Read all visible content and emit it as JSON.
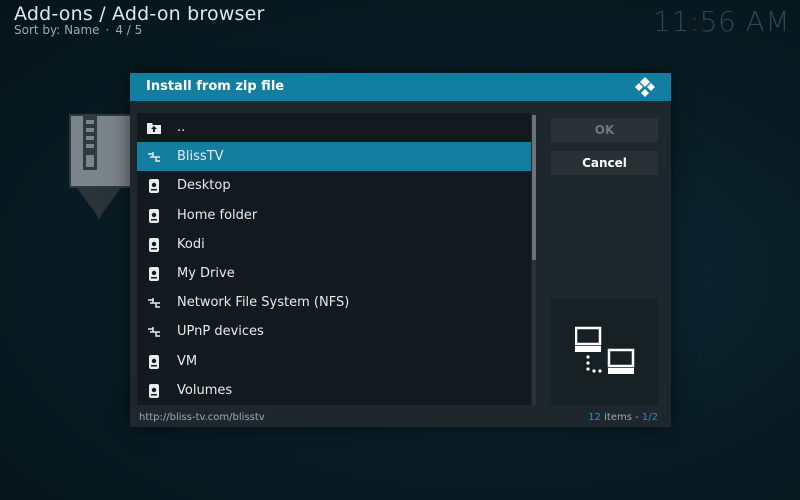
{
  "header": {
    "title": "Add-ons / Add-on browser",
    "sort_label": "Sort by: Name",
    "separator": "·",
    "position": "4 / 5",
    "clock": "11:56 AM"
  },
  "dialog": {
    "title": "Install from zip file",
    "icon": "kodi-logo-icon",
    "items": [
      {
        "label": "..",
        "icon": "folder-up-icon",
        "selected": false
      },
      {
        "label": "BlissTV",
        "icon": "network-icon",
        "selected": true
      },
      {
        "label": "Desktop",
        "icon": "drive-icon",
        "selected": false
      },
      {
        "label": "Home folder",
        "icon": "drive-icon",
        "selected": false
      },
      {
        "label": "Kodi",
        "icon": "drive-icon",
        "selected": false
      },
      {
        "label": "My Drive",
        "icon": "drive-icon",
        "selected": false
      },
      {
        "label": "Network File System (NFS)",
        "icon": "network-icon",
        "selected": false
      },
      {
        "label": "UPnP devices",
        "icon": "network-icon",
        "selected": false
      },
      {
        "label": "VM",
        "icon": "drive-icon",
        "selected": false
      },
      {
        "label": "Volumes",
        "icon": "drive-icon",
        "selected": false
      }
    ],
    "ok_label": "OK",
    "cancel_label": "Cancel",
    "preview_icon": "network-computers-icon",
    "footer": {
      "path": "http://bliss-tv.com/blisstv",
      "item_count": "12",
      "items_text": "items",
      "dash": "-",
      "page": "1/2"
    }
  },
  "colors": {
    "accent": "#127fa0",
    "selection": "#137ea0",
    "dialog_bg": "#1e272c",
    "list_bg": "#13191c"
  }
}
